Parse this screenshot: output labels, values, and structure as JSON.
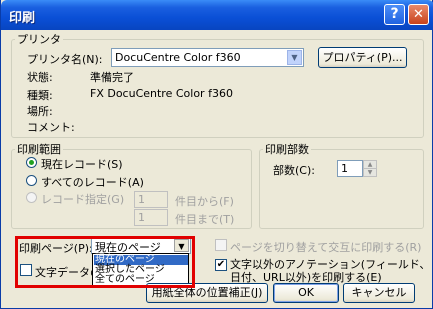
{
  "window": {
    "title": "印刷",
    "help_glyph": "?",
    "close_glyph": "✕"
  },
  "printer": {
    "legend": "プリンタ",
    "name_label": "プリンタ名(N):",
    "name_value": "DocuCentre Color f360",
    "properties_button": "プロパティ(P)...",
    "status_label": "状態:",
    "status_value": "準備完了",
    "type_label": "種類:",
    "type_value": "FX DocuCentre Color f360",
    "location_label": "場所:",
    "comment_label": "コメント:"
  },
  "range": {
    "legend": "印刷範囲",
    "options": [
      {
        "label": "現在レコード(S)",
        "checked": true,
        "enabled": true
      },
      {
        "label": "すべてのレコード(A)",
        "checked": false,
        "enabled": true
      },
      {
        "label": "レコード指定(G)",
        "checked": false,
        "enabled": false
      }
    ],
    "from_value": "1",
    "from_label": "件目から(F)",
    "to_value": "1",
    "to_label": "件目まで(T)"
  },
  "copies": {
    "legend": "印刷部数",
    "label": "部数(C):",
    "value": "1"
  },
  "page": {
    "label": "印刷ページ(P):",
    "selected": "現在のページ",
    "options": [
      "現在のページ",
      "選択したページ",
      "全てのページ"
    ],
    "highlighted_index": 0
  },
  "text_data_check": {
    "label": "文字データの",
    "checked": false
  },
  "alternate_check": {
    "label": "ページを切り替えて交互に印刷する(R)",
    "checked": false,
    "enabled": false
  },
  "annotation_check": {
    "line1": "文字以外のアノテーション(フィールド、",
    "line2": "日付、URL以外)を印刷する(E)",
    "checked": true
  },
  "buttons": {
    "position_correction": "用紙全体の位置補正(J)",
    "ok": "OK",
    "cancel": "キャンセル"
  },
  "colors": {
    "titlebar": "#0a4fd6",
    "highlight": "#316ac5",
    "callout": "#e10000"
  }
}
